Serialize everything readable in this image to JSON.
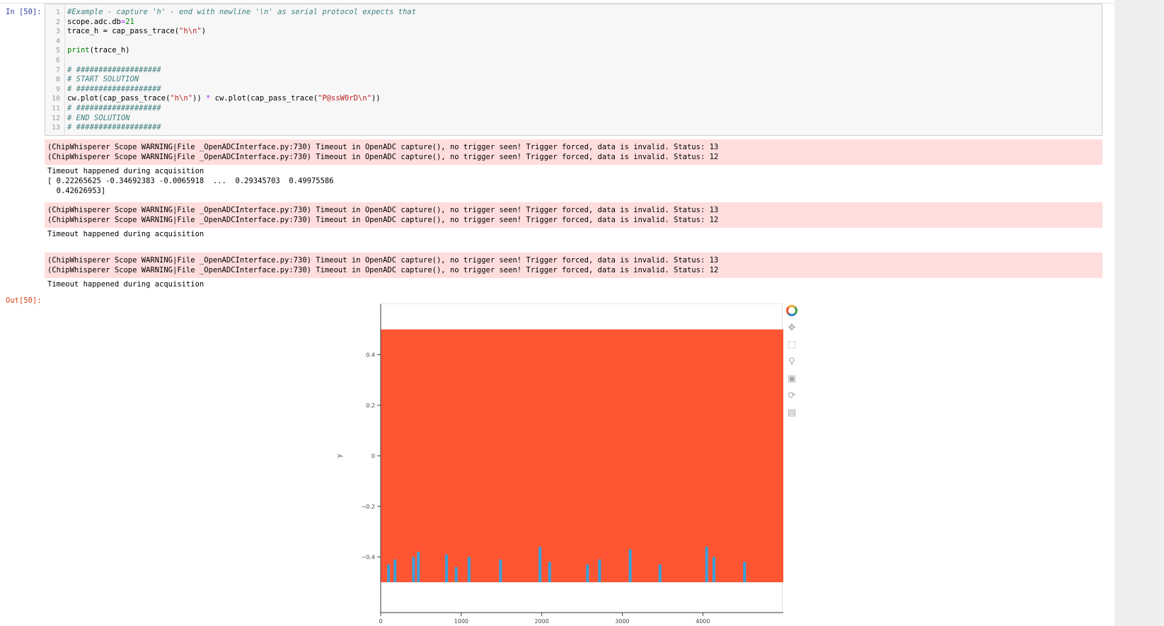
{
  "prompts": {
    "input": "In [50]:",
    "output": "Out[50]:"
  },
  "code": {
    "lines": [
      {
        "n": "1",
        "tokens": [
          {
            "t": "#Example - capture 'h' - end with newline '\\n' as serial protocol expects that",
            "c": "comment"
          }
        ]
      },
      {
        "n": "2",
        "tokens": [
          {
            "t": "scope.adc.db",
            "c": ""
          },
          {
            "t": "=",
            "c": "op"
          },
          {
            "t": "21",
            "c": "number"
          }
        ]
      },
      {
        "n": "3",
        "tokens": [
          {
            "t": "trace_h = cap_pass_trace(",
            "c": ""
          },
          {
            "t": "\"h\\n\"",
            "c": "string"
          },
          {
            "t": ")",
            "c": ""
          }
        ]
      },
      {
        "n": "4",
        "tokens": []
      },
      {
        "n": "5",
        "tokens": [
          {
            "t": "print",
            "c": "keyword"
          },
          {
            "t": "(trace_h)",
            "c": ""
          }
        ]
      },
      {
        "n": "6",
        "tokens": []
      },
      {
        "n": "7",
        "tokens": [
          {
            "t": "# ###################",
            "c": "comment"
          }
        ]
      },
      {
        "n": "8",
        "tokens": [
          {
            "t": "# START SOLUTION",
            "c": "comment"
          }
        ]
      },
      {
        "n": "9",
        "tokens": [
          {
            "t": "# ###################",
            "c": "comment"
          }
        ]
      },
      {
        "n": "10",
        "tokens": [
          {
            "t": "cw.plot(cap_pass_trace(",
            "c": ""
          },
          {
            "t": "\"h\\n\"",
            "c": "string"
          },
          {
            "t": ")) ",
            "c": ""
          },
          {
            "t": "*",
            "c": "op"
          },
          {
            "t": " cw.plot(cap_pass_trace(",
            "c": ""
          },
          {
            "t": "\"P@ssW0rD\\n\"",
            "c": "string"
          },
          {
            "t": "))",
            "c": ""
          }
        ]
      },
      {
        "n": "11",
        "tokens": [
          {
            "t": "# ###################",
            "c": "comment"
          }
        ]
      },
      {
        "n": "12",
        "tokens": [
          {
            "t": "# END SOLUTION",
            "c": "comment"
          }
        ]
      },
      {
        "n": "13",
        "tokens": [
          {
            "t": "# ###################",
            "c": "comment"
          }
        ]
      }
    ]
  },
  "outputs": {
    "warn_a_1": "(ChipWhisperer Scope WARNING|File _OpenADCInterface.py:730) Timeout in OpenADC capture(), no trigger seen! Trigger forced, data is invalid. Status: 13",
    "warn_a_2": "(ChipWhisperer Scope WARNING|File _OpenADCInterface.py:730) Timeout in OpenADC capture(), no trigger seen! Trigger forced, data is invalid. Status: 12",
    "stdout_a_1": "Timeout happened during acquisition",
    "stdout_a_2": "[ 0.22265625 -0.34692383 -0.0065918  ...  0.29345703  0.49975586",
    "stdout_a_3": "  0.42626953]",
    "warn_b_1": "(ChipWhisperer Scope WARNING|File _OpenADCInterface.py:730) Timeout in OpenADC capture(), no trigger seen! Trigger forced, data is invalid. Status: 13",
    "warn_b_2": "(ChipWhisperer Scope WARNING|File _OpenADCInterface.py:730) Timeout in OpenADC capture(), no trigger seen! Trigger forced, data is invalid. Status: 12",
    "stdout_b_1": "Timeout happened during acquisition",
    "warn_c_1": "(ChipWhisperer Scope WARNING|File _OpenADCInterface.py:730) Timeout in OpenADC capture(), no trigger seen! Trigger forced, data is invalid. Status: 13",
    "warn_c_2": "(ChipWhisperer Scope WARNING|File _OpenADCInterface.py:730) Timeout in OpenADC capture(), no trigger seen! Trigger forced, data is invalid. Status: 12",
    "stdout_c_1": "Timeout happened during acquisition"
  },
  "toolbar": {
    "icons": [
      "bokeh-logo-icon",
      "pan-icon",
      "box-zoom-icon",
      "wheel-zoom-icon",
      "save-icon",
      "reset-icon",
      "hover-icon"
    ],
    "glyphs": [
      "",
      "✥",
      "⬚",
      "⚲",
      "▣",
      "⟳",
      "▤"
    ]
  },
  "colors": {
    "trace_fill": "#ff5533",
    "spike": "#3aa0d8"
  },
  "chart_data": {
    "type": "area",
    "xlabel": "",
    "ylabel": "y",
    "xlim": [
      0,
      4999
    ],
    "ylim": [
      -0.62,
      0.6
    ],
    "xticks": [
      0,
      1000,
      2000,
      3000,
      4000
    ],
    "xtick_labels": [
      "0",
      "1000",
      "2000",
      "3000",
      "4000"
    ],
    "yticks": [
      -0.4,
      -0.2,
      0,
      0.2,
      0.4
    ],
    "ytick_labels": [
      "−0.4",
      "−0.2",
      "0",
      "0.2",
      "0.4"
    ],
    "series": [
      {
        "upper": 0.5,
        "lower": -0.5,
        "x_range": [
          0,
          4999
        ]
      }
    ],
    "spikes_x": [
      80,
      160,
      390,
      450,
      800,
      920,
      1080,
      1470,
      1960,
      2080,
      2550,
      2700,
      3080,
      3450,
      4030,
      4120,
      4500
    ],
    "spikes_height": [
      -0.43,
      -0.41,
      -0.4,
      -0.38,
      -0.39,
      -0.44,
      -0.4,
      -0.41,
      -0.36,
      -0.42,
      -0.43,
      -0.41,
      -0.37,
      -0.43,
      -0.36,
      -0.4,
      -0.42
    ],
    "grid": false,
    "legend": "none"
  }
}
